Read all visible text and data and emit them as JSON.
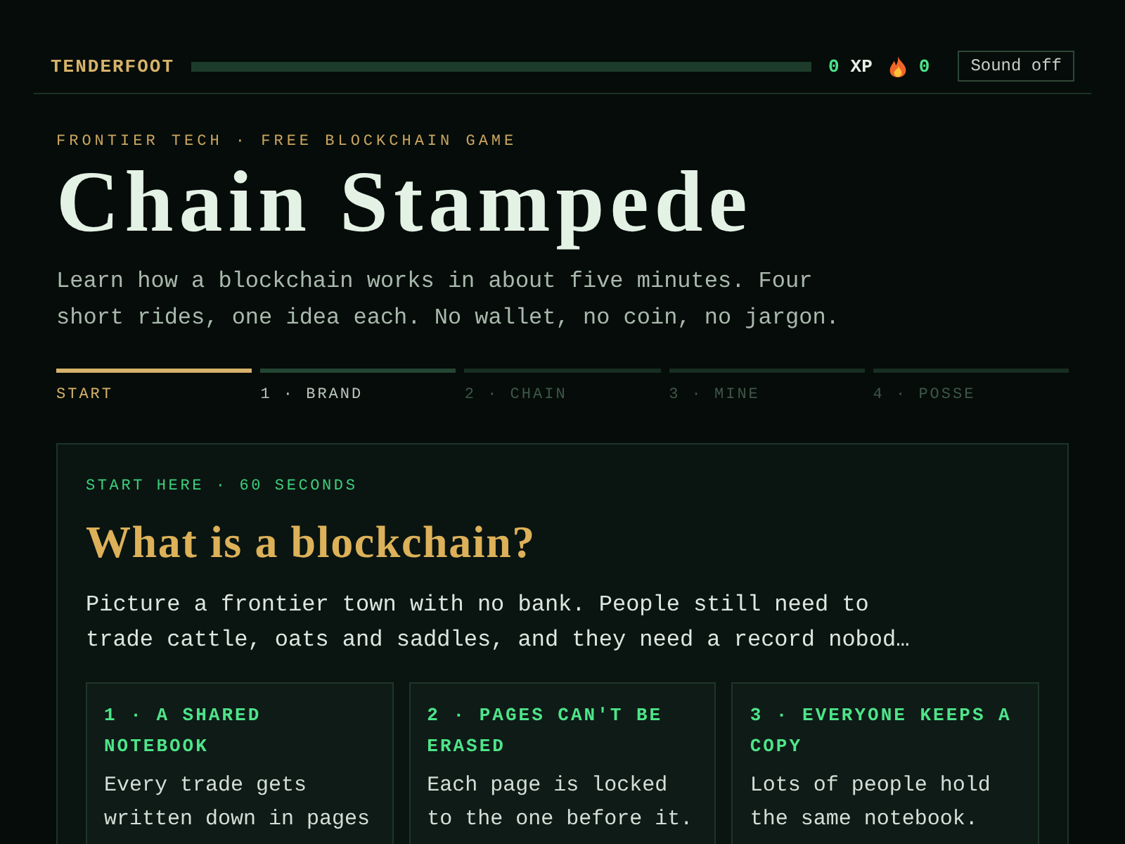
{
  "topbar": {
    "rank": "TENDERFOOT",
    "xp": {
      "value": "0",
      "label": "XP",
      "level": 0
    },
    "streak": {
      "value": "0"
    },
    "sound_button": "Sound off"
  },
  "hero": {
    "eyebrow": "FRONTIER TECH · FREE BLOCKCHAIN GAME",
    "title": "Chain Stampede",
    "description": "Learn how a blockchain works in about five minutes. Four short rides, one idea each. No wallet, no coin, no jargon."
  },
  "steps": [
    {
      "label": "START",
      "selected": true,
      "locked": false
    },
    {
      "label": "1 · BRAND",
      "selected": false,
      "locked": false
    },
    {
      "label": "2 · CHAIN",
      "selected": false,
      "locked": true
    },
    {
      "label": "3 · MINE",
      "selected": false,
      "locked": true
    },
    {
      "label": "4 · POSSE",
      "selected": false,
      "locked": true
    }
  ],
  "lesson": {
    "eyebrow": "START HERE · 60 SECONDS",
    "title": "What is a blockchain?",
    "text": "Picture a frontier town with no bank. People still need to trade cattle, oats and saddles, and they need a record nobod…",
    "ideas": [
      {
        "title": "1 · A SHARED NOTEBOOK",
        "text": "Every trade gets written down in pages"
      },
      {
        "title": "2 · PAGES CAN'T BE ERASED",
        "text": "Each page is locked to the one before it."
      },
      {
        "title": "3 · EVERYONE KEEPS A COPY",
        "text": "Lots of people hold the same notebook."
      }
    ]
  }
}
